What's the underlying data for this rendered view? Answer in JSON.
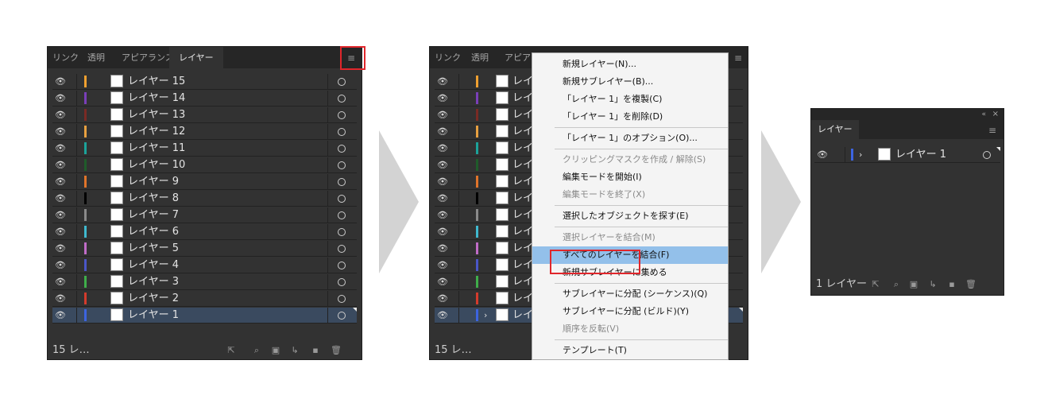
{
  "panel1": {
    "tabs": [
      "リンク",
      "透明",
      "アピアランス",
      "レイヤー"
    ],
    "layers": [
      {
        "name": "レイヤー 15",
        "color": "#f0a030"
      },
      {
        "name": "レイヤー 14",
        "color": "#7a3fb8"
      },
      {
        "name": "レイヤー 13",
        "color": "#7a2a24"
      },
      {
        "name": "レイヤー 12",
        "color": "#e8a040"
      },
      {
        "name": "レイヤー 11",
        "color": "#1ca39a"
      },
      {
        "name": "レイヤー 10",
        "color": "#1f5c2a"
      },
      {
        "name": "レイヤー 9",
        "color": "#e0742a"
      },
      {
        "name": "レイヤー 8",
        "color": "#000000"
      },
      {
        "name": "レイヤー 7",
        "color": "#8a8a8a"
      },
      {
        "name": "レイヤー 6",
        "color": "#3fb9cf"
      },
      {
        "name": "レイヤー 5",
        "color": "#c06cc7"
      },
      {
        "name": "レイヤー 4",
        "color": "#4a56c8"
      },
      {
        "name": "レイヤー 3",
        "color": "#3fae4a"
      },
      {
        "name": "レイヤー 2",
        "color": "#d43b2c"
      },
      {
        "name": "レイヤー 1",
        "color": "#3c64e0",
        "selected": true
      }
    ],
    "footer_count": "15 レ…"
  },
  "panel2": {
    "tabs": [
      "リンク",
      "透明",
      "アピアランス"
    ],
    "footer_count": "15 レ…"
  },
  "context_menu": {
    "items": [
      {
        "label": "新規レイヤー(N)...",
        "state": "normal"
      },
      {
        "label": "新規サブレイヤー(B)...",
        "state": "normal"
      },
      {
        "label": "「レイヤー 1」を複製(C)",
        "state": "normal"
      },
      {
        "label": "「レイヤー 1」を削除(D)",
        "state": "normal"
      },
      {
        "sep": true
      },
      {
        "label": "「レイヤー 1」のオプション(O)...",
        "state": "normal"
      },
      {
        "sep": true
      },
      {
        "label": "クリッピングマスクを作成 / 解除(S)",
        "state": "disabled"
      },
      {
        "label": "編集モードを開始(I)",
        "state": "normal"
      },
      {
        "label": "編集モードを終了(X)",
        "state": "disabled"
      },
      {
        "sep": true
      },
      {
        "label": "選択したオブジェクトを探す(E)",
        "state": "normal"
      },
      {
        "sep": true
      },
      {
        "label": "選択レイヤーを結合(M)",
        "state": "disabled"
      },
      {
        "label": "すべてのレイヤーを結合(F)",
        "state": "highlighted"
      },
      {
        "label": "新規サブレイヤーに集める",
        "state": "normal"
      },
      {
        "sep": true
      },
      {
        "label": "サブレイヤーに分配 (シーケンス)(Q)",
        "state": "normal"
      },
      {
        "label": "サブレイヤーに分配 (ビルド)(Y)",
        "state": "normal"
      },
      {
        "label": "順序を反転(V)",
        "state": "disabled"
      },
      {
        "sep": true
      },
      {
        "label": "テンプレート(T)",
        "state": "normal"
      }
    ]
  },
  "panel3": {
    "tab": "レイヤー",
    "layer": {
      "name": "レイヤー 1",
      "color": "#3c64e0"
    },
    "footer_count": "1 レイヤー"
  },
  "colors": {
    "panel_bg": "#323232",
    "tab_bar": "#262626",
    "highlight_red": "#e0262b",
    "menu_hover": "#93c0ea"
  },
  "icons": [
    "eye-icon",
    "menu-icon",
    "expand-arrow-icon",
    "visibility-ring-icon",
    "collect-export-icon",
    "locate-object-icon",
    "clipping-mask-icon",
    "new-sublayer-icon",
    "new-layer-icon",
    "trash-icon",
    "panel-collapse-icon",
    "panel-close-icon"
  ]
}
